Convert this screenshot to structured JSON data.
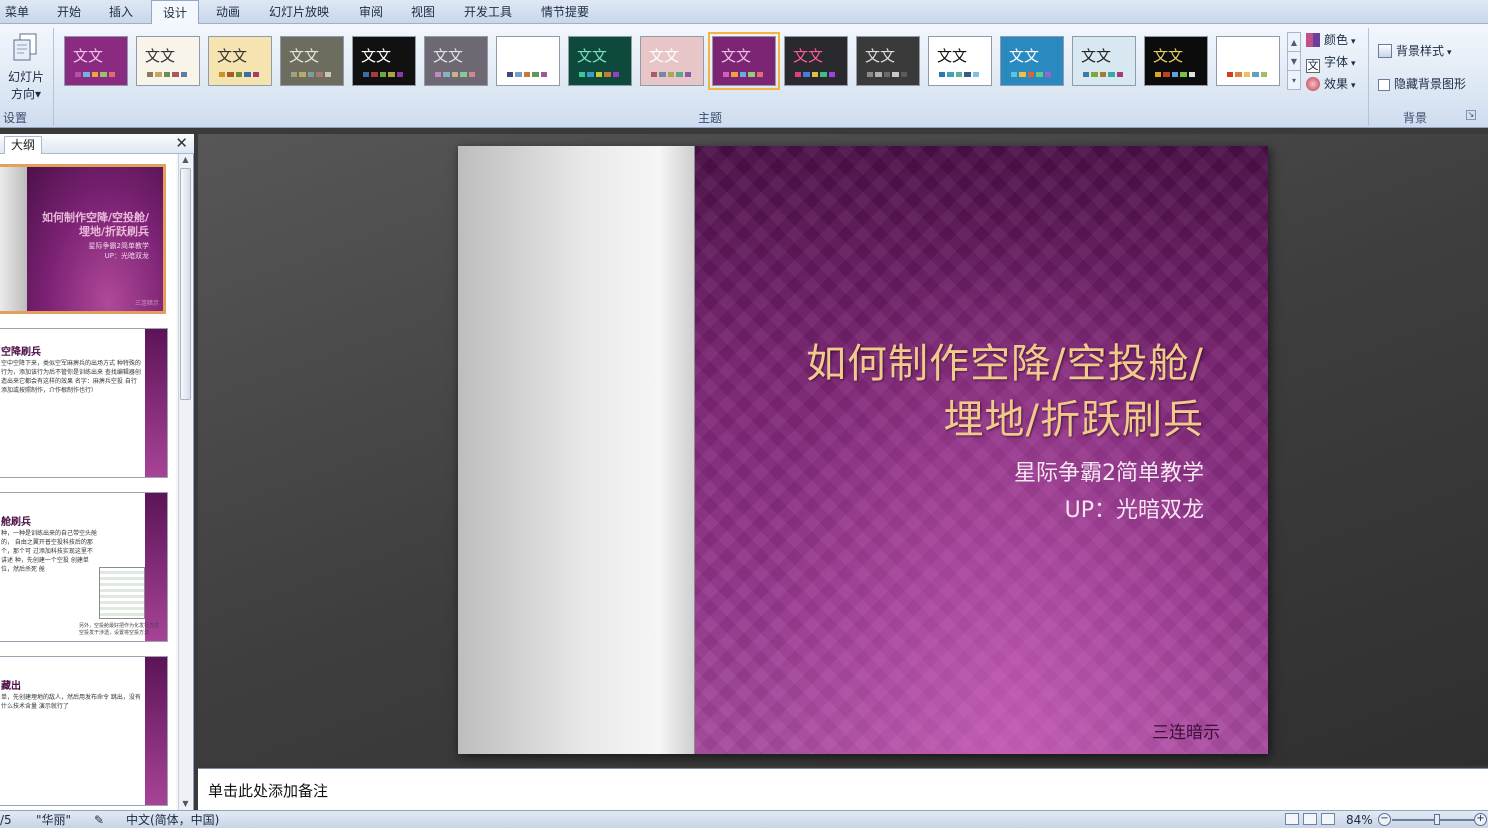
{
  "tabs": [
    {
      "label": "菜单",
      "active": false
    },
    {
      "label": "开始",
      "active": false
    },
    {
      "label": "插入",
      "active": false
    },
    {
      "label": "设计",
      "active": true
    },
    {
      "label": "动画",
      "active": false
    },
    {
      "label": "幻灯片放映",
      "active": false
    },
    {
      "label": "审阅",
      "active": false
    },
    {
      "label": "视图",
      "active": false
    },
    {
      "label": "开发工具",
      "active": false
    },
    {
      "label": "情节提要",
      "active": false
    }
  ],
  "ribbon": {
    "orientation": {
      "line1": "幻灯片",
      "line2": "方向",
      "arrow": "▾"
    },
    "group_setup": "设置",
    "group_themes": "主题",
    "group_background": "背景",
    "themes_sample_text": "文文",
    "colors_label": "颜色",
    "fonts_label": "字体",
    "effects_label": "效果",
    "bg_style_label": "背景样式",
    "hide_bg_label": "隐藏背景图形",
    "dropdown_arrow": "▾",
    "themes": [
      {
        "bg": "#8a2a80",
        "fg": "#f4c4e8",
        "bars": [
          "#c04aa8",
          "#6bb5e0",
          "#f2a23c",
          "#8cc86a",
          "#e36b6b"
        ],
        "selected": false
      },
      {
        "bg": "#f8f4ea",
        "fg": "#333333",
        "bars": [
          "#8b7a5a",
          "#c9a45a",
          "#6b8e5a",
          "#a85a5a",
          "#5a7ea8"
        ],
        "selected": false
      },
      {
        "bg": "#f5e4b0",
        "fg": "#333333",
        "bars": [
          "#c8922a",
          "#a85a2a",
          "#6b8e3a",
          "#3a6ea8",
          "#a83a6e"
        ],
        "selected": false
      },
      {
        "bg": "#6d6d5f",
        "fg": "#e8e6d8",
        "bars": [
          "#9ca37a",
          "#b8a86a",
          "#7a9ca3",
          "#a37a7a",
          "#c8c8b0"
        ],
        "selected": false
      },
      {
        "bg": "#111111",
        "fg": "#ffffff",
        "bars": [
          "#3a6ea8",
          "#a83a3a",
          "#6ea83a",
          "#a8a83a",
          "#8a3aa8"
        ],
        "selected": false
      },
      {
        "bg": "#6e6873",
        "fg": "#e6e0ea",
        "bars": [
          "#c08ac8",
          "#8ab0c8",
          "#c8b08a",
          "#8ac89a",
          "#c88a8a"
        ],
        "selected": false
      },
      {
        "bg": "#ffffff",
        "fg": "#ffffff",
        "bars": [
          "#3a4a7a",
          "#7a9ac8",
          "#c87a3a",
          "#5a9a5a",
          "#9a5a9a"
        ],
        "selected": false
      },
      {
        "bg": "#0e4a3c",
        "fg": "#7fe0c0",
        "bars": [
          "#3ac89a",
          "#3a9ac8",
          "#c8c83a",
          "#c87a3a",
          "#9a3ac8"
        ],
        "selected": false
      },
      {
        "bg": "#e8c6c8",
        "fg": "#ffffff",
        "bars": [
          "#a85a6e",
          "#6e8aa8",
          "#a8a85a",
          "#5aa88a",
          "#8a5aa8"
        ],
        "selected": false
      },
      {
        "bg": "#7d2575",
        "fg": "#f0c0e6",
        "bars": [
          "#d060b8",
          "#f0a040",
          "#60b0e0",
          "#90d070",
          "#e07070"
        ],
        "selected": true
      },
      {
        "bg": "#2a2a2e",
        "fg": "#ff5a9a",
        "bars": [
          "#e04080",
          "#4080e0",
          "#e0c040",
          "#40c080",
          "#a040e0"
        ],
        "selected": false
      },
      {
        "bg": "#3a3a3a",
        "fg": "#dddddd",
        "bars": [
          "#8a8a8a",
          "#b0b0b0",
          "#6a6a6a",
          "#c8c8c8",
          "#5a5a5a"
        ],
        "selected": false
      },
      {
        "bg": "#ffffff",
        "fg": "#111111",
        "bars": [
          "#2a7ab0",
          "#40a0c0",
          "#60b0a0",
          "#3a5a8a",
          "#80c0e0"
        ],
        "selected": false
      },
      {
        "bg": "#2a8ac0",
        "fg": "#ffffff",
        "bars": [
          "#60c0e0",
          "#f0c040",
          "#e06040",
          "#60d080",
          "#a060d0"
        ],
        "selected": false
      },
      {
        "bg": "#d8e8f0",
        "fg": "#222222",
        "bars": [
          "#3a7aa8",
          "#7aa83a",
          "#a87a3a",
          "#3aa8a8",
          "#a83a7a"
        ],
        "selected": false
      },
      {
        "bg": "#0c0c0c",
        "fg": "#e8d060",
        "bars": [
          "#e0a020",
          "#c04020",
          "#60a0e0",
          "#80c040",
          "#e0e0e0"
        ],
        "selected": false
      },
      {
        "bg": "#ffffff",
        "fg": "#ffffff",
        "bars": [
          "#d04020",
          "#e08040",
          "#f0c060",
          "#60a0c0",
          "#a0c060"
        ],
        "selected": false
      }
    ]
  },
  "outline_pane": {
    "tab_label": "大纲",
    "close": "✕",
    "thumb1": {
      "title": "如何制作空降/空投舱/埋地/折跃刷兵",
      "sub1": "星际争霸2简单教学",
      "sub2": "UP：光暗双龙",
      "foot": "三连暗示"
    },
    "thumb2": {
      "head": "空降刷兵",
      "body": "空中空降下来，类似空军麻痹兵的出场方式 种特殊的行为，添加该行为后不管你是训练出来 查找编辑器创造出来它都会有这样的效果 名字：麻痹兵空投 自行添加或按照制作，介作根制作也行）"
    },
    "thumb3": {
      "head": "舱刷兵",
      "body": "种，一种是训练出来的自己带空头舱的， 自由之翼开普空投科技后的那个，那个可 过添加科技实现这里不讲述 种，先创建一个空投 创建单位，然后杀死 舱",
      "note": "另外，空投舱最好把作为化发行方式 空投发干涉透，设置将空投方法"
    },
    "thumb4": {
      "head": "藏出",
      "body": "单，先创建埋地的敌人，然后用发布命令 跳出，没有什么技术含量 演示就行了"
    }
  },
  "slide": {
    "title": "如何制作空降/空投舱/埋地/折跃刷兵",
    "subtitle1": "星际争霸2简单教学",
    "subtitle2": "UP：光暗双龙",
    "footer": "三连暗示"
  },
  "notes_placeholder": "单击此处添加备注",
  "status": {
    "slide_count": "/5",
    "theme_name": "\"华丽\"",
    "language": "中文(简体，中国)",
    "zoom": "84%",
    "minus": "−",
    "plus": "+"
  }
}
